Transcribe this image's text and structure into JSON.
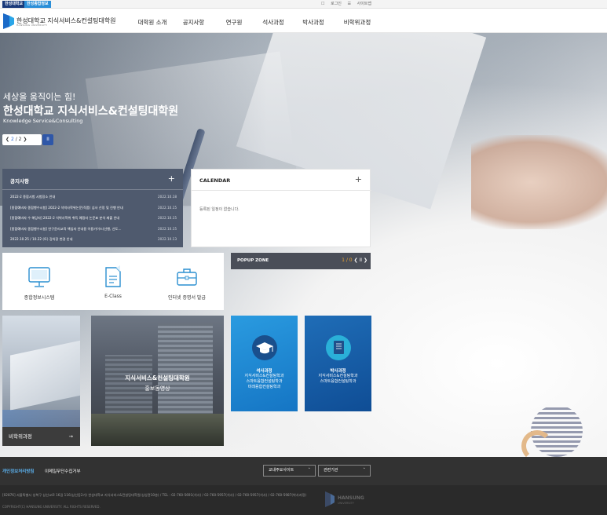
{
  "util": {
    "tab1": "한성대학교",
    "tab2": "한성종합정보",
    "login": "로그인",
    "sitemap": "사이트맵"
  },
  "header": {
    "logo_name": "한성대학교 지식서비스&컨설팅대학원",
    "logo_sub": "HANSUNG UNIVERSITY",
    "nav": [
      "대학원 소개",
      "공지사항",
      "연구원",
      "석사과정",
      "박사과정",
      "비학위과정"
    ]
  },
  "hero": {
    "line1": "세상을 움직이는 힘!",
    "line2": "한성대학교 지식서비스&컨설팅대학원",
    "line3": "Knowledge Service&Consulting",
    "pager_current": "2",
    "pager_sep": "/",
    "pager_total": "2",
    "pause": "II"
  },
  "notice": {
    "title": "공지사항",
    "plus": "+",
    "items": [
      {
        "title": "2022-2 종합시험 시험장소 안내",
        "date": "2022.10.18"
      },
      {
        "title": "[종합예비자 종합행수시험] 2022-2 석박사학위논문(작품) 심사 선정 및 진행 안내",
        "date": "2022.10.15"
      },
      {
        "title": "[종합예비자 수 해당자] 2022-2 석박사학위 취득 예정자 논문표 분석 제출 안내",
        "date": "2022.10.15"
      },
      {
        "title": "[종합예비자 종합행수시험] 연구윤리교육 책임자 안내용 이용가이드(선행, 선도...",
        "date": "2022.10.15"
      },
      {
        "title": "2022.10.25 / 10.22 (토) 강의장 변경 안내",
        "date": "2022.10.13"
      }
    ]
  },
  "calendar": {
    "title": "CALENDAR",
    "plus": "+",
    "empty": "등록된 일정이 없습니다."
  },
  "quick": [
    {
      "label": "종합정보시스템",
      "icon": "monitor-icon"
    },
    {
      "label": "E-Class",
      "icon": "document-icon"
    },
    {
      "label": "인터넷 증명서 발급",
      "icon": "briefcase-icon"
    }
  ],
  "popup": {
    "title": "POPUP ZONE",
    "counter": "1 / 0"
  },
  "cards": {
    "mba": "비학위과정",
    "video_line1": "지식서비스&컨설팅대학원",
    "video_line2": "홍보동영상",
    "ms_title": "석사과정",
    "ms_lines": [
      "지식서비스&컨설팅학과",
      "스마트융합컨설팅학과",
      "미래융합컨설팅학과"
    ],
    "phd_title": "박사과정",
    "phd_lines": [
      "지식서비스&컨설팅학과",
      "스마트융합컨설팅학과"
    ]
  },
  "footer": {
    "privacy": "개인정보처리방침",
    "email": "이메일무단수집거부",
    "select1": "교내주요사이트",
    "select2": "관련기관",
    "address": "[02876] 서울특별시 성북구 삼선교로 16길 116(삼선동2가) 한성대학교 지식서비스&컨설팅대학원(상상관10층) / TEL : 02-760-5691(석사) / 02-760-5957(석사) / 02-760-5957(석사) / 02-760-5987(박사과정)",
    "copyright": "COPYRIGHT(C) HANSUNG UNIVERSITY. ALL RIGHTS RESERVED.",
    "logo_text": "HANSUNG",
    "logo_sub": "UNIVERSITY"
  },
  "colors": {
    "brand_navy": "#1a3a7a",
    "brand_blue": "#2b8fd8",
    "notice_bg": "#4f5a6e",
    "popup_bg": "#4a4e58",
    "footer_bg": "#2a2a2a"
  }
}
